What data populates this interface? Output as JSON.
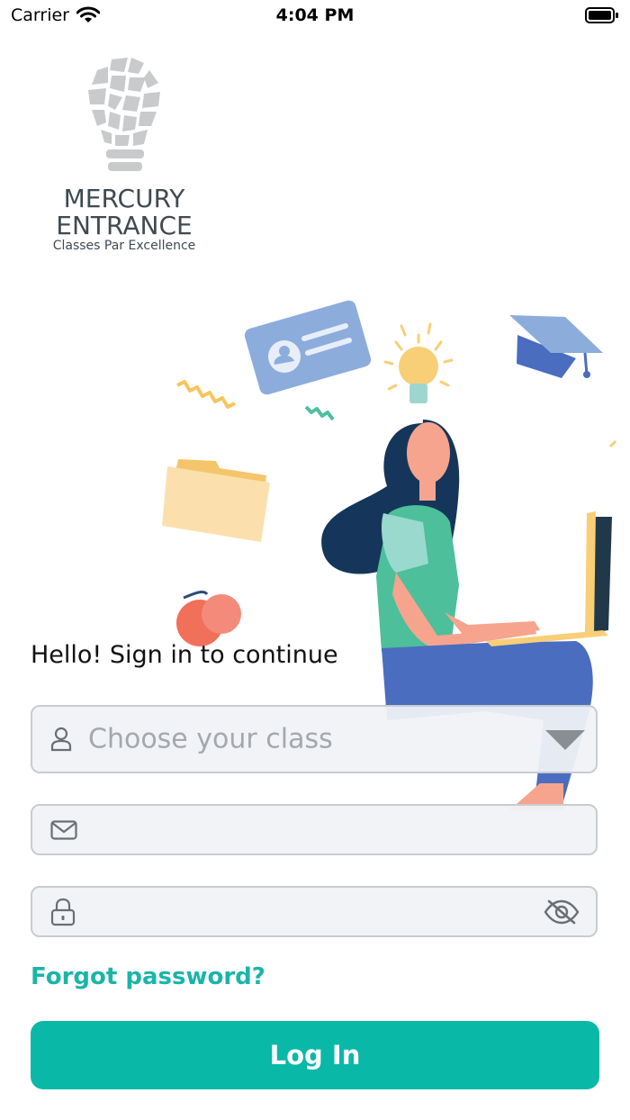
{
  "status_bar": {
    "carrier": "Carrier",
    "time": "4:04 PM"
  },
  "brand": {
    "line1": "MERCURY",
    "line2": "ENTRANCE",
    "tagline": "Classes Par Excellence"
  },
  "form": {
    "greeting": "Hello! Sign in to continue",
    "class_placeholder": "Choose your class",
    "email_value": "",
    "password_value": "",
    "forgot_label": "Forgot password?",
    "login_label": "Log In"
  },
  "colors": {
    "accent": "#0ab8a8",
    "link": "#1bb5a8",
    "brand_text": "#3f4a52"
  },
  "icons": [
    "wifi-icon",
    "battery-icon",
    "user-icon",
    "dropdown-arrow-icon",
    "mail-icon",
    "lock-icon",
    "eye-off-icon"
  ]
}
